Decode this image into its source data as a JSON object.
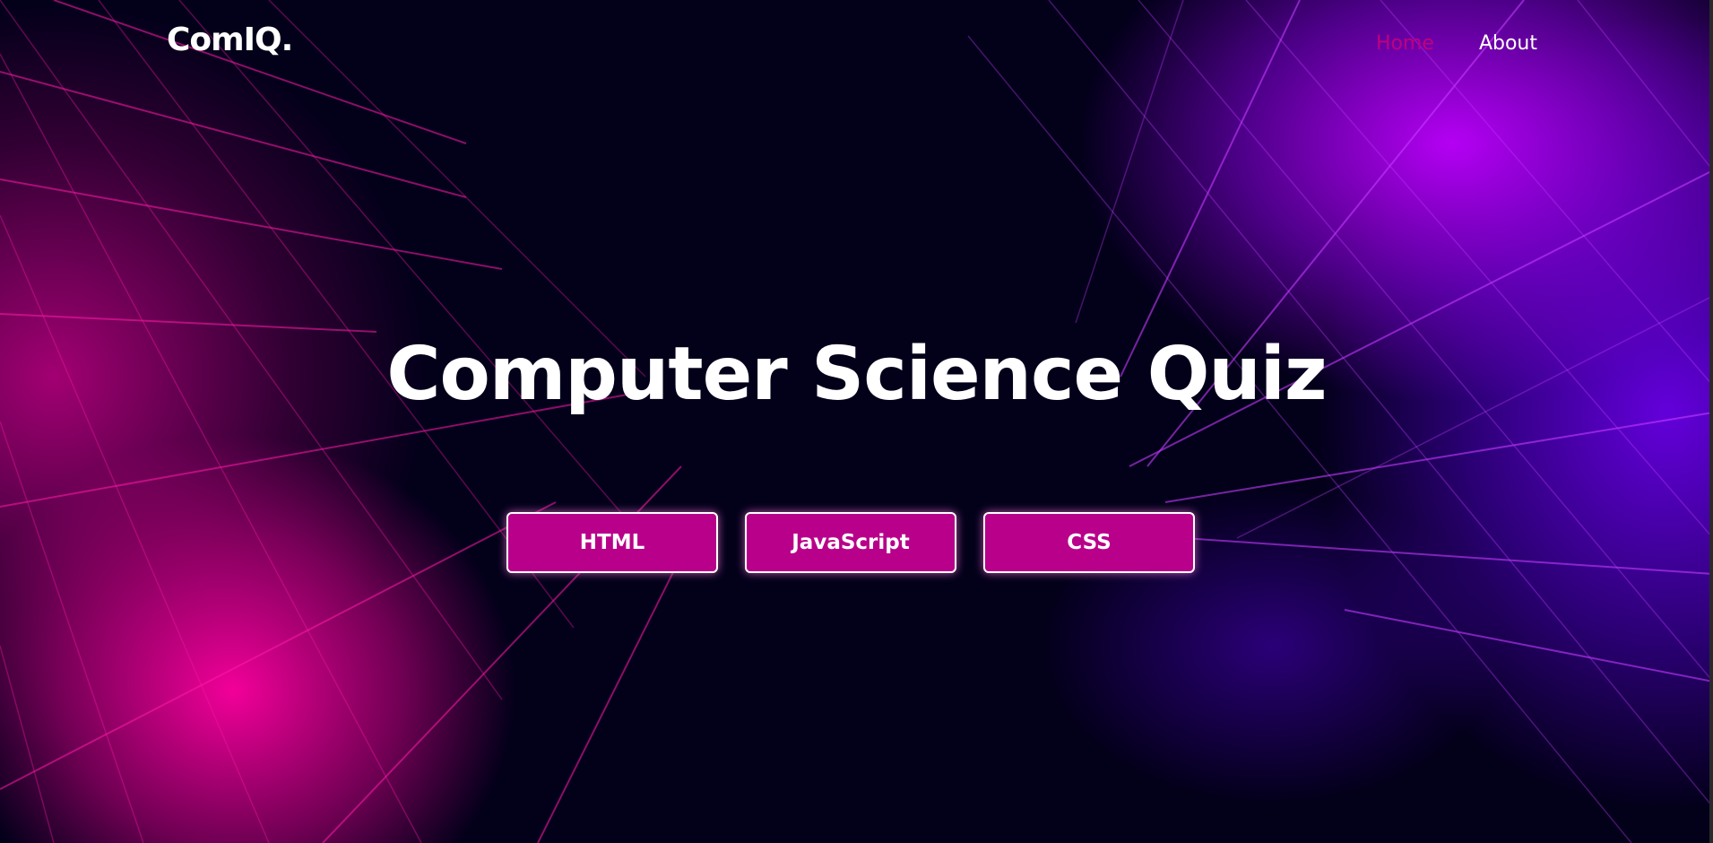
{
  "header": {
    "logo": "ComIQ.",
    "nav": [
      {
        "label": "Home",
        "active": true,
        "color": "#c0007e"
      },
      {
        "label": "About",
        "active": false,
        "color": "#ffffff"
      }
    ]
  },
  "hero": {
    "title": "Computer Science Quiz",
    "buttons": [
      "HTML",
      "JavaScript",
      "CSS"
    ]
  },
  "colors": {
    "background": "#03001a",
    "button_fill": "#b8008a",
    "button_border": "#ffffff",
    "accent_pink": "#ff00a0",
    "accent_purple": "#8a00ff"
  }
}
